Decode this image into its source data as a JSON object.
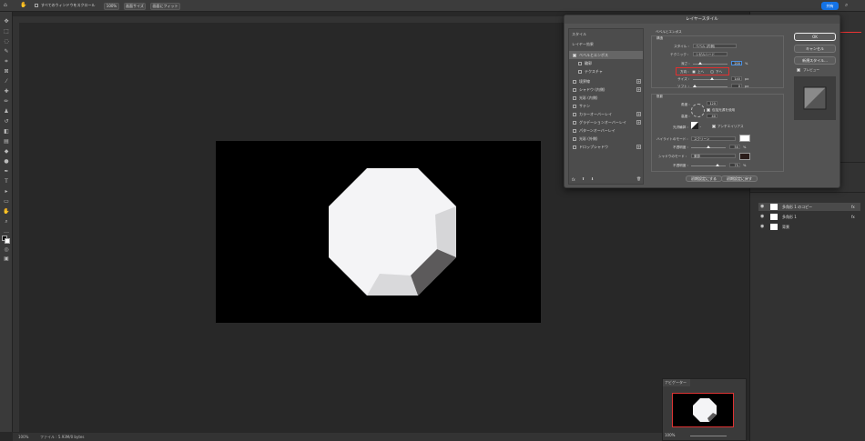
{
  "options_bar": {
    "scroll_all_label": "すべてのウィンドウをスクロール",
    "zoom_100": "100%",
    "fit_screen": "画面サイズ",
    "fill_screen": "画面にフィット",
    "share": "共有"
  },
  "status": {
    "zoom": "100%",
    "file_info": "ファイル : 5.93M/0 bytes"
  },
  "layers": [
    {
      "name": "多角形 1 のコピー",
      "fx": "fx"
    },
    {
      "name": "多角形 1",
      "fx": "fx"
    },
    {
      "name": "背景",
      "fx": ""
    }
  ],
  "navigator": {
    "title": "ナビゲーター",
    "zoom": "100%"
  },
  "dialog": {
    "title": "レイヤースタイル",
    "left_header": "スタイル",
    "blend_options": "レイヤー効果",
    "styles": [
      {
        "label": "ベベルとエンボス",
        "checked": true,
        "plus": false
      },
      {
        "label": "輪郭",
        "checked": false,
        "plus": false
      },
      {
        "label": "テクスチャ",
        "checked": false,
        "plus": false
      },
      {
        "label": "境界線",
        "checked": false,
        "plus": true
      },
      {
        "label": "シャドウ (内側)",
        "checked": false,
        "plus": true
      },
      {
        "label": "光彩 (内側)",
        "checked": false,
        "plus": false
      },
      {
        "label": "サテン",
        "checked": false,
        "plus": false
      },
      {
        "label": "カラーオーバーレイ",
        "checked": false,
        "plus": true
      },
      {
        "label": "グラデーションオーバーレイ",
        "checked": false,
        "plus": true
      },
      {
        "label": "パターンオーバーレイ",
        "checked": false,
        "plus": false
      },
      {
        "label": "光彩 (外側)",
        "checked": false,
        "plus": false
      },
      {
        "label": "ドロップシャドウ",
        "checked": false,
        "plus": true
      }
    ],
    "bevel": {
      "section": "ベベルとエンボス",
      "structure": "構造",
      "style_label": "スタイル :",
      "style_value": "ベベル (内側)",
      "technique_label": "テクニック :",
      "technique_value": "シゼルハード",
      "depth_label": "深さ :",
      "depth_value": "200",
      "depth_unit": "%",
      "direction_label": "方向 :",
      "direction_up": "上へ",
      "direction_down": "下へ",
      "size_label": "サイズ :",
      "size_value": "140",
      "size_unit": "px",
      "soften_label": "ソフト :",
      "soften_value": "0",
      "soften_unit": "px"
    },
    "shading": {
      "section": "陰影",
      "angle_label": "角度 :",
      "angle_value": "120",
      "global_light": "包括光源を使用",
      "altitude_label": "高度 :",
      "altitude_value": "40",
      "gloss_label": "光沢輪郭 :",
      "antialias": "アンチエイリアス",
      "highlight_mode_label": "ハイライトのモード :",
      "highlight_mode_value": "スクリーン",
      "highlight_opacity_label": "不透明度 :",
      "highlight_opacity_value": "50",
      "shadow_mode_label": "シャドウのモード :",
      "shadow_mode_value": "乗算",
      "shadow_opacity_label": "不透明度 :",
      "shadow_opacity_value": "75",
      "pct": "%"
    },
    "default_set": "初期設定にする",
    "default_reset": "初期設定に戻す",
    "ok": "OK",
    "cancel": "キャンセル",
    "new_style": "新規スタイル...",
    "preview": "プレビュー",
    "fx_icon": "fx"
  },
  "colors": {
    "highlight_swatch": "#ffffff",
    "shadow_swatch": "#2b1d1a",
    "canvas_bg": "#000000",
    "selection_red": "#e03030"
  }
}
